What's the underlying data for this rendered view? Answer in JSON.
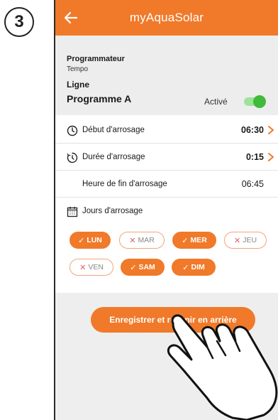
{
  "step_number": "3",
  "app": {
    "title": "myAquaSolar"
  },
  "header": {
    "programmer_label": "Programmateur",
    "programmer_value": "Tempo",
    "line_label": "Ligne",
    "program_name": "Programme A",
    "active_label": "Activé",
    "active": true
  },
  "rows": {
    "start_label": "Début d'arrosage",
    "start_value": "06:30",
    "duration_label": "Durée d'arrosage",
    "duration_value": "0:15",
    "end_label": "Heure de fin d'arrosage",
    "end_value": "06:45",
    "days_label": "Jours d'arrosage"
  },
  "days": [
    {
      "label": "LUN",
      "active": true
    },
    {
      "label": "MAR",
      "active": false
    },
    {
      "label": "MER",
      "active": true
    },
    {
      "label": "JEU",
      "active": false
    },
    {
      "label": "VEN",
      "active": false
    },
    {
      "label": "SAM",
      "active": true
    },
    {
      "label": "DIM",
      "active": true
    }
  ],
  "save_button": "Enregistrer et revenir en arrière",
  "colors": {
    "accent": "#f07a2a",
    "toggle_on": "#3fba3b",
    "cross": "#e85f5f"
  }
}
